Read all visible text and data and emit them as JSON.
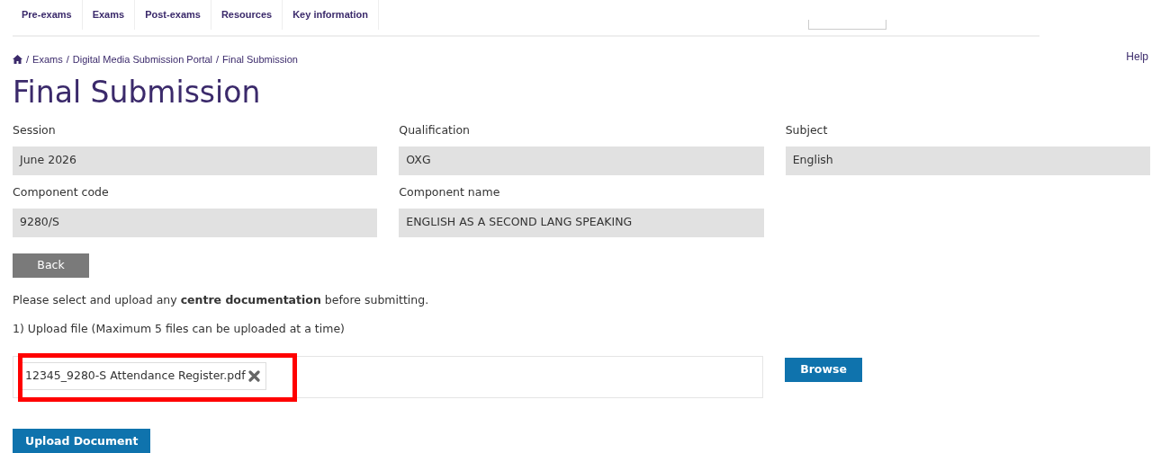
{
  "nav": {
    "items": [
      {
        "label": "Pre-exams"
      },
      {
        "label": "Exams"
      },
      {
        "label": "Post-exams"
      },
      {
        "label": "Resources"
      },
      {
        "label": "Key information"
      }
    ]
  },
  "breadcrumb": [
    {
      "separator": "/",
      "label": "Exams"
    },
    {
      "separator": "/",
      "label": "Digital Media Submission Portal"
    },
    {
      "separator": "/",
      "label": "Final Submission"
    }
  ],
  "help": "Help",
  "title": "Final Submission",
  "fields": [
    {
      "label": "Session",
      "value": "June 2026"
    },
    {
      "label": "Qualification",
      "value": "OXG"
    },
    {
      "label": "Subject",
      "value": "English"
    },
    {
      "label": "Component code",
      "value": "9280/S"
    },
    {
      "label": "Component name",
      "value": "ENGLISH AS A SECOND LANG SPEAKING"
    }
  ],
  "back_button": "Back",
  "instruction": "Please select and upload any **centre documentation** before submitting.",
  "upload_label": "1) Upload file (Maximum 5 files can be uploaded at a time)",
  "files": [
    {
      "name": "12345_9280-S Attendance Register.pdf"
    }
  ],
  "browse_button": "Browse",
  "upload_button": "Upload Document"
}
